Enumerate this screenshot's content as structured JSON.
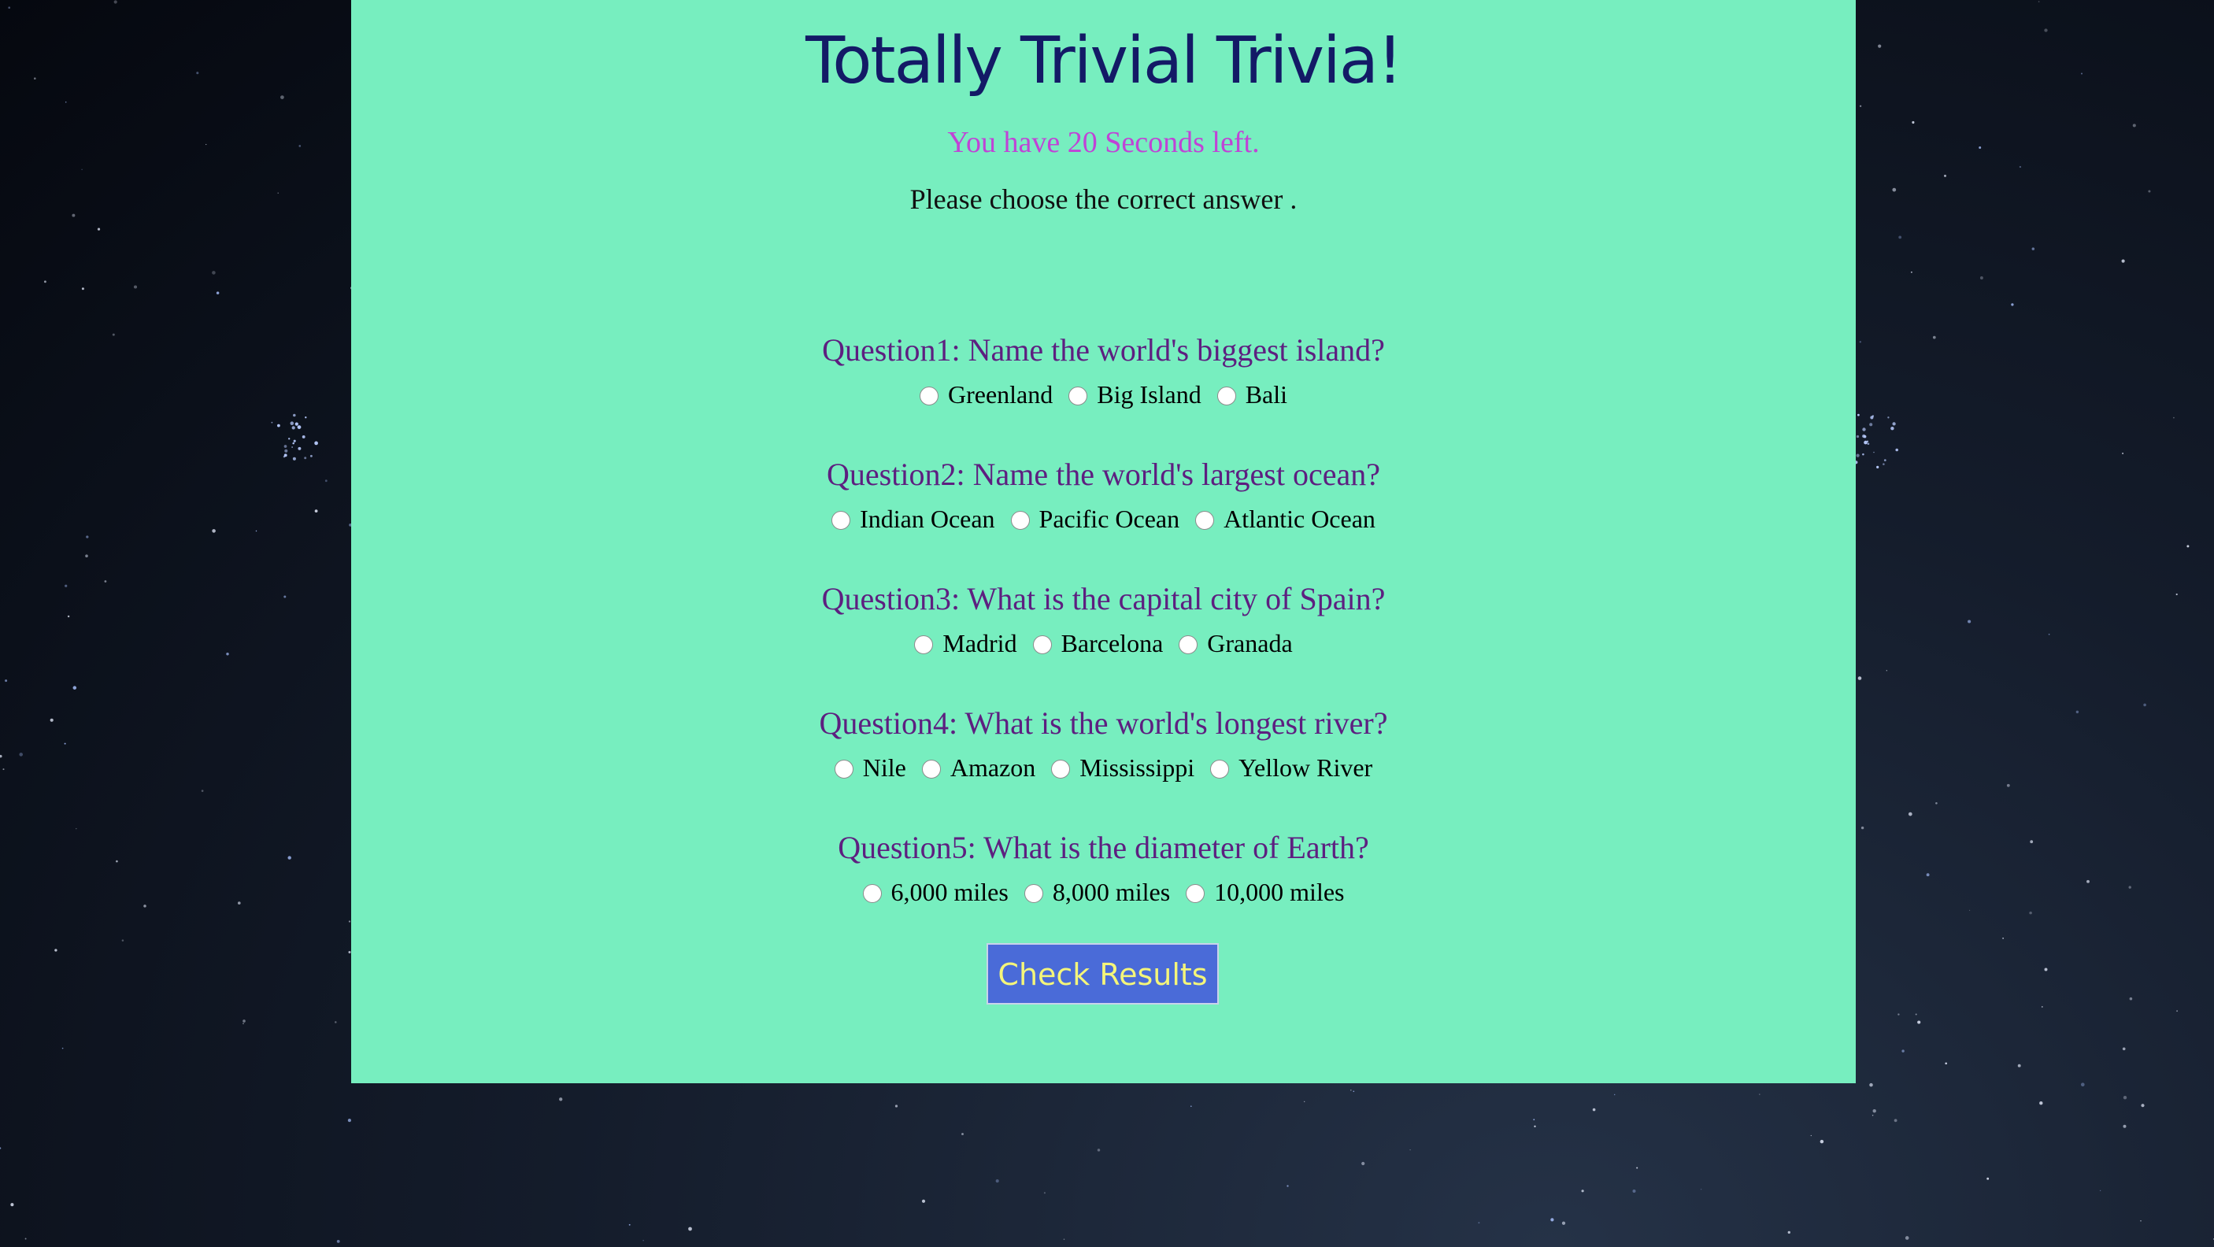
{
  "page": {
    "title": "Totally Trivial Trivia!",
    "timer_text": "You have 20 Seconds left.",
    "instructions": "Please choose the correct answer ."
  },
  "questions": [
    {
      "text": "Question1: Name the world's biggest island?",
      "options": [
        "Greenland",
        "Big Island",
        "Bali"
      ]
    },
    {
      "text": "Question2: Name the world's largest ocean?",
      "options": [
        "Indian Ocean",
        "Pacific Ocean",
        "Atlantic Ocean"
      ]
    },
    {
      "text": "Question3: What is the capital city of Spain?",
      "options": [
        "Madrid",
        "Barcelona",
        "Granada"
      ]
    },
    {
      "text": "Question4: What is the world's longest river?",
      "options": [
        "Nile",
        "Amazon",
        "Mississippi",
        "Yellow River"
      ]
    },
    {
      "text": "Question5: What is the diameter of Earth?",
      "options": [
        "6,000 miles",
        "8,000 miles",
        "10,000 miles"
      ]
    }
  ],
  "check_button": {
    "label": "Check Results"
  },
  "colors": {
    "panel_bg": "#77eebf",
    "title": "#131a66",
    "timer": "#c043d6",
    "question": "#5d1f80",
    "button_bg": "#4a6bd8",
    "button_text": "#f4f57a"
  }
}
